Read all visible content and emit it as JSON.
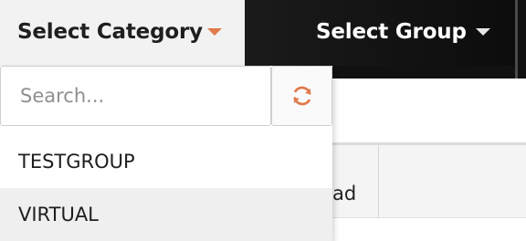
{
  "header": {
    "category_label": "Select Category",
    "group_label": "Select Group"
  },
  "dropdown": {
    "search_placeholder": "Search...",
    "refresh_icon": "refresh-icon",
    "options": [
      {
        "label": "TESTGROUP",
        "highlighted": false
      },
      {
        "label": "VIRTUAL",
        "highlighted": true
      }
    ]
  },
  "background": {
    "partial_column_header": "ad"
  },
  "colors": {
    "accent": "#e07a4a",
    "dark_header": "#111111",
    "light_header": "#f2f2f2"
  }
}
